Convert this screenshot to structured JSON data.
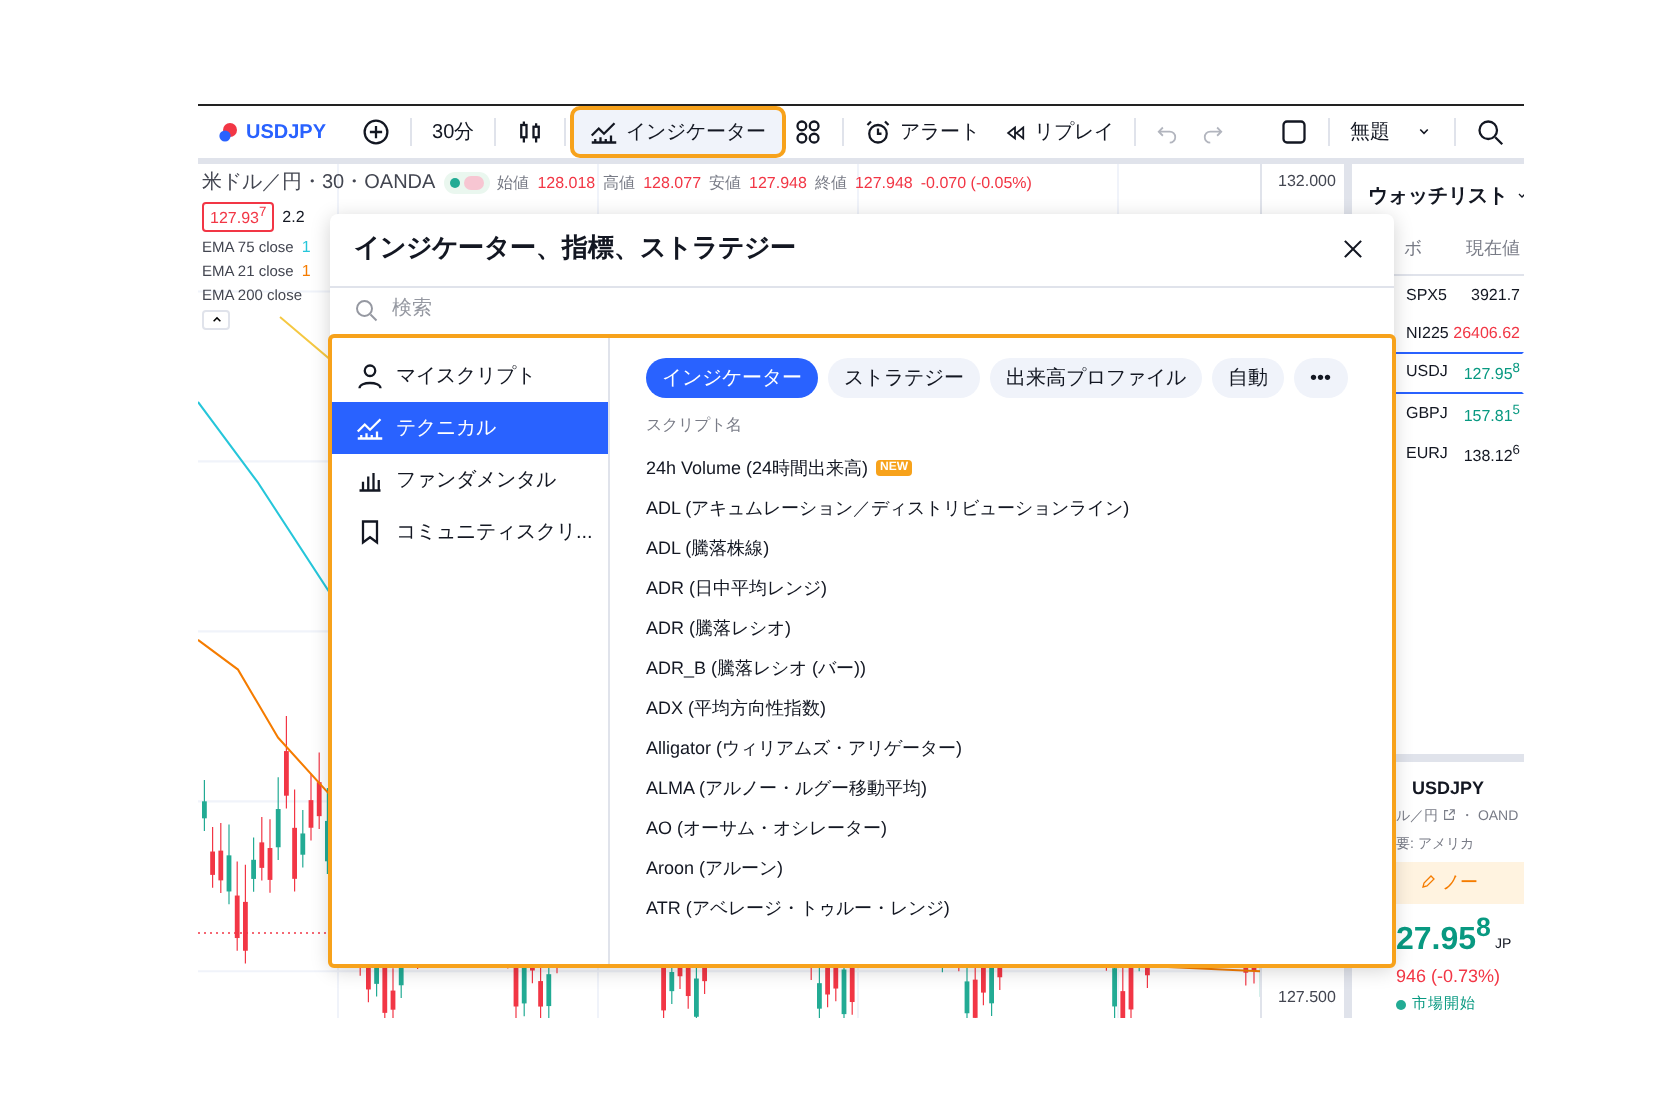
{
  "toolbar": {
    "symbol": "USDJPY",
    "interval": "30分",
    "indicators_button": {
      "label": "インジケーター",
      "highlighted": true
    },
    "alert_button": "アラート",
    "replay_button": "リプレイ",
    "layout_name": "無題"
  },
  "legend": {
    "title": "米ドル／円・30・OANDA",
    "ohlc": [
      {
        "label": "始値",
        "value": "128.018"
      },
      {
        "label": "高値",
        "value": "128.077"
      },
      {
        "label": "安値",
        "value": "127.948"
      },
      {
        "label": "終値",
        "value": "127.948"
      }
    ],
    "change": "-0.070 (-0.05%)",
    "price_tag": "127.93$^{7}$",
    "spread": "2.2",
    "ema": [
      {
        "name": "EMA 75 close",
        "value": "1",
        "color": "#26c6da"
      },
      {
        "name": "EMA 21 close",
        "value": "1",
        "color": "#f57c00"
      },
      {
        "name": "EMA 200 close",
        "color": "#f5c842"
      }
    ]
  },
  "price_axis": [
    "132.000",
    "127.500"
  ],
  "watchlist": {
    "title": "ウォッチリスト",
    "column_1": "ボ",
    "column_2": "現在値",
    "rows": [
      {
        "symbol": "SPX5",
        "price": "3921.7",
        "color": "#131722",
        "selected": false
      },
      {
        "symbol": "NI225",
        "price": "26406.62",
        "color": "#f23645",
        "selected": false
      },
      {
        "symbol": "USDJ",
        "price": "127.95$^{8}$",
        "color": "#089981",
        "selected": true
      },
      {
        "symbol": "GBPJ",
        "price": "157.81$^{5}$",
        "color": "#089981",
        "selected": false
      },
      {
        "symbol": "EURJ",
        "price": "138.12$^{6}$",
        "color": "#131722",
        "selected": false
      }
    ]
  },
  "details": {
    "symbol": "USDJPY",
    "name": "ル／円",
    "exchange": "・ OAND",
    "category": "要: アメリカ",
    "note_button": "ノー",
    "price": "27.95$^{8}$",
    "currency": "JP",
    "change": "946 (-0.73%)",
    "status": "市場開始"
  },
  "dialog": {
    "title": "インジケーター、指標、ストラテジー",
    "search": {
      "placeholder": "検索"
    },
    "categories": [
      {
        "label": "マイスクリプト",
        "kind": "user",
        "selected": false
      },
      {
        "label": "テクニカル",
        "kind": "technical",
        "selected": true
      },
      {
        "label": "ファンダメンタル",
        "kind": "fundamental",
        "selected": false
      },
      {
        "label": "コミュニティスクリ...",
        "kind": "community",
        "selected": false
      }
    ],
    "filters": [
      {
        "label": "インジケーター",
        "selected": true
      },
      {
        "label": "ストラテジー",
        "selected": false
      },
      {
        "label": "出来高プロファイル",
        "selected": false
      },
      {
        "label": "自動",
        "selected": false
      },
      {
        "label": "•••",
        "selected": false
      }
    ],
    "list_header": "スクリプト名",
    "scripts": [
      {
        "name": "24h Volume (24時間出来高)",
        "badge": "NEW"
      },
      {
        "name": "ADL (アキュムレーション／ディストリビューションライン)"
      },
      {
        "name": "ADL (騰落株線)"
      },
      {
        "name": "ADR (日中平均レンジ)"
      },
      {
        "name": "ADR (騰落レシオ)"
      },
      {
        "name": "ADR_B (騰落レシオ (バー))"
      },
      {
        "name": "ADX (平均方向性指数)"
      },
      {
        "name": "Alligator (ウィリアムズ・アリゲーター)"
      },
      {
        "name": "ALMA (アルノー・ルグー移動平均)"
      },
      {
        "name": "AO (オーサム・オシレーター)"
      },
      {
        "name": "Aroon (アルーン)"
      },
      {
        "name": "ATR (アベレージ・トゥルー・レンジ)"
      }
    ]
  }
}
